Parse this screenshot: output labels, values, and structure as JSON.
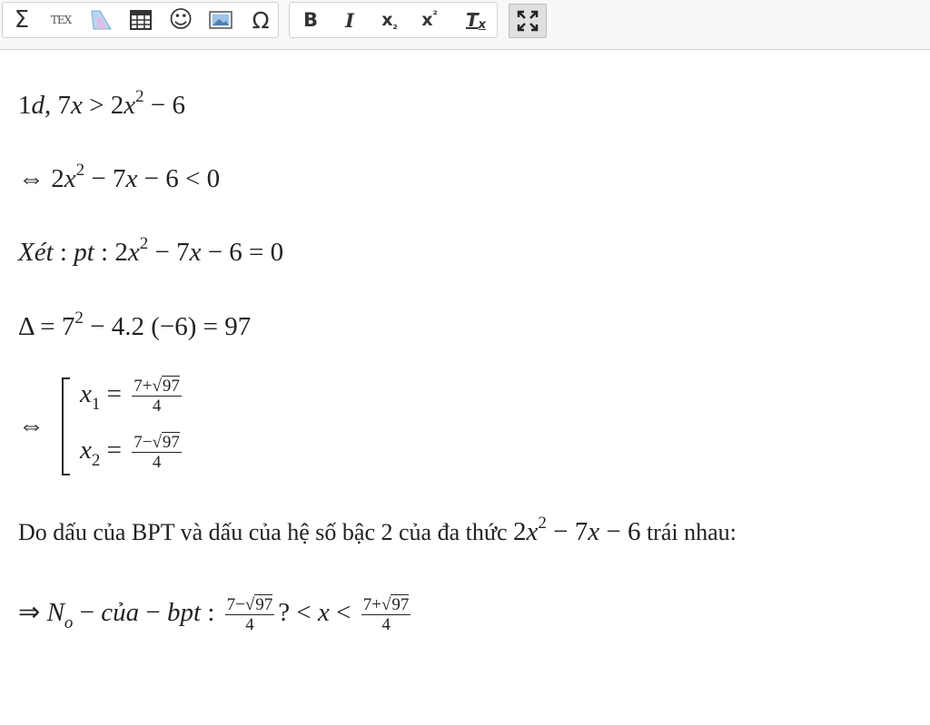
{
  "toolbar": {
    "group1": [
      {
        "name": "sum-icon",
        "glyph": "Σ"
      },
      {
        "name": "tex-icon",
        "glyph": "TEX"
      },
      {
        "name": "shape-icon",
        "glyph": ""
      },
      {
        "name": "table-icon",
        "glyph": ""
      },
      {
        "name": "smiley-icon",
        "glyph": "☺"
      },
      {
        "name": "image-icon",
        "glyph": ""
      },
      {
        "name": "omega-icon",
        "glyph": "Ω"
      }
    ],
    "group2": [
      {
        "name": "bold-icon",
        "glyph": "B"
      },
      {
        "name": "italic-icon",
        "glyph": "I"
      },
      {
        "name": "subscript-icon",
        "glyph": "x",
        "script": "₂"
      },
      {
        "name": "superscript-icon",
        "glyph": "x",
        "script": "²"
      },
      {
        "name": "clear-format-icon",
        "glyph": "T",
        "script": "x"
      }
    ],
    "fullscreen": {
      "name": "fullscreen-icon",
      "glyph": "⛶"
    }
  },
  "content": {
    "l1": {
      "a": "1",
      "b": "d",
      "c": ", 7",
      "d": "x",
      "e": " > 2",
      "f": "x",
      "sup": "2",
      "g": " − 6"
    },
    "l2": {
      "a": "⇔ 2",
      "b": "x",
      "sup": "2",
      "c": " − 7",
      "d": "x",
      "e": " − 6 < 0"
    },
    "l3": {
      "a": "X",
      "b": "ét",
      "c": " : ",
      "d": "pt",
      "e": " : 2",
      "f": "x",
      "sup": "2",
      "g": " − 7",
      "h": "x",
      "i": " − 6 = 0"
    },
    "l4": {
      "a": "Δ = 7",
      "sup": "2",
      "b": " − 4.2 (−6) = 97"
    },
    "l5": {
      "arrow": "⇔",
      "x1": {
        "var": "x",
        "sub": "1",
        "eq": " = ",
        "num_pre": "7+√",
        "num_rad": "97",
        "den": "4"
      },
      "x2": {
        "var": "x",
        "sub": "2",
        "eq": " = ",
        "num_pre": "7−√",
        "num_rad": "97",
        "den": "4"
      }
    },
    "l6": {
      "text": "Do dấu của BPT và dấu của hệ số bậc 2 của đa thức ",
      "m_a": "2",
      "m_b": "x",
      "m_sup": "2",
      "m_c": " − 7",
      "m_d": "x",
      "m_e": " − 6",
      "tail": " trái nhau:"
    },
    "l7": {
      "a": "⇒ ",
      "b": "N",
      "sub": "o",
      "c": " − ",
      "d": "của",
      "e": " − ",
      "f": "bpt",
      "g": " : ",
      "f1": {
        "pre": "7−√",
        "rad": "97",
        "den": "4"
      },
      "h": "? < ",
      "i": "x",
      "j": " < ",
      "f2": {
        "pre": "7+√",
        "rad": "97",
        "den": "4"
      }
    }
  }
}
